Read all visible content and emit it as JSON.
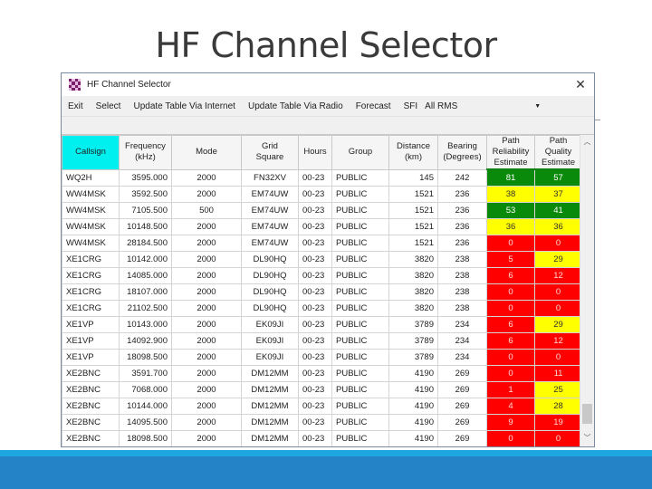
{
  "slide": {
    "title": "HF Channel Selector"
  },
  "window": {
    "title": "HF Channel Selector",
    "app_icon": "checkered-app-icon",
    "close_glyph": "✕"
  },
  "menu": {
    "items": [
      "Exit",
      "Select",
      "Update Table Via Internet",
      "Update Table Via Radio",
      "Forecast"
    ],
    "sfi_label": "SFI",
    "group_select": {
      "value": "All RMS",
      "arrow": "▼"
    }
  },
  "table": {
    "columns": [
      {
        "label": "Callsign",
        "sorted": true
      },
      {
        "label": "Frequency\n(kHz)"
      },
      {
        "label": "Mode"
      },
      {
        "label": "Grid\nSquare"
      },
      {
        "label": "Hours"
      },
      {
        "label": "Group"
      },
      {
        "label": "Distance\n(km)"
      },
      {
        "label": "Bearing\n(Degrees)"
      },
      {
        "label": "Path\nReliability\nEstimate"
      },
      {
        "label": "Path\nQuality\nEstimate"
      }
    ],
    "colors": {
      "green": "#0a8a0a",
      "yellow": "#ffff00",
      "red": "#ff0000",
      "sorted_header": "#00f0f0"
    },
    "rows": [
      {
        "callsign": "WQ2H",
        "freq": "3595.000",
        "mode": "2000",
        "grid": "FN32XV",
        "hours": "00-23",
        "group": "PUBLIC",
        "distance": "145",
        "bearing": "242",
        "reliability": "81",
        "rel_color": "green",
        "quality": "57",
        "qual_color": "green"
      },
      {
        "callsign": "WW4MSK",
        "freq": "3592.500",
        "mode": "2000",
        "grid": "EM74UW",
        "hours": "00-23",
        "group": "PUBLIC",
        "distance": "1521",
        "bearing": "236",
        "reliability": "38",
        "rel_color": "yellow",
        "quality": "37",
        "qual_color": "yellow"
      },
      {
        "callsign": "WW4MSK",
        "freq": "7105.500",
        "mode": "500",
        "grid": "EM74UW",
        "hours": "00-23",
        "group": "PUBLIC",
        "distance": "1521",
        "bearing": "236",
        "reliability": "53",
        "rel_color": "green",
        "quality": "41",
        "qual_color": "green"
      },
      {
        "callsign": "WW4MSK",
        "freq": "10148.500",
        "mode": "2000",
        "grid": "EM74UW",
        "hours": "00-23",
        "group": "PUBLIC",
        "distance": "1521",
        "bearing": "236",
        "reliability": "36",
        "rel_color": "yellow",
        "quality": "36",
        "qual_color": "yellow"
      },
      {
        "callsign": "WW4MSK",
        "freq": "28184.500",
        "mode": "2000",
        "grid": "EM74UW",
        "hours": "00-23",
        "group": "PUBLIC",
        "distance": "1521",
        "bearing": "236",
        "reliability": "0",
        "rel_color": "red",
        "quality": "0",
        "qual_color": "red"
      },
      {
        "callsign": "XE1CRG",
        "freq": "10142.000",
        "mode": "2000",
        "grid": "DL90HQ",
        "hours": "00-23",
        "group": "PUBLIC",
        "distance": "3820",
        "bearing": "238",
        "reliability": "5",
        "rel_color": "red",
        "quality": "29",
        "qual_color": "yellow"
      },
      {
        "callsign": "XE1CRG",
        "freq": "14085.000",
        "mode": "2000",
        "grid": "DL90HQ",
        "hours": "00-23",
        "group": "PUBLIC",
        "distance": "3820",
        "bearing": "238",
        "reliability": "6",
        "rel_color": "red",
        "quality": "12",
        "qual_color": "red"
      },
      {
        "callsign": "XE1CRG",
        "freq": "18107.000",
        "mode": "2000",
        "grid": "DL90HQ",
        "hours": "00-23",
        "group": "PUBLIC",
        "distance": "3820",
        "bearing": "238",
        "reliability": "0",
        "rel_color": "red",
        "quality": "0",
        "qual_color": "red"
      },
      {
        "callsign": "XE1CRG",
        "freq": "21102.500",
        "mode": "2000",
        "grid": "DL90HQ",
        "hours": "00-23",
        "group": "PUBLIC",
        "distance": "3820",
        "bearing": "238",
        "reliability": "0",
        "rel_color": "red",
        "quality": "0",
        "qual_color": "red"
      },
      {
        "callsign": "XE1VP",
        "freq": "10143.000",
        "mode": "2000",
        "grid": "EK09JI",
        "hours": "00-23",
        "group": "PUBLIC",
        "distance": "3789",
        "bearing": "234",
        "reliability": "6",
        "rel_color": "red",
        "quality": "29",
        "qual_color": "yellow"
      },
      {
        "callsign": "XE1VP",
        "freq": "14092.900",
        "mode": "2000",
        "grid": "EK09JI",
        "hours": "00-23",
        "group": "PUBLIC",
        "distance": "3789",
        "bearing": "234",
        "reliability": "6",
        "rel_color": "red",
        "quality": "12",
        "qual_color": "red"
      },
      {
        "callsign": "XE1VP",
        "freq": "18098.500",
        "mode": "2000",
        "grid": "EK09JI",
        "hours": "00-23",
        "group": "PUBLIC",
        "distance": "3789",
        "bearing": "234",
        "reliability": "0",
        "rel_color": "red",
        "quality": "0",
        "qual_color": "red"
      },
      {
        "callsign": "XE2BNC",
        "freq": "3591.700",
        "mode": "2000",
        "grid": "DM12MM",
        "hours": "00-23",
        "group": "PUBLIC",
        "distance": "4190",
        "bearing": "269",
        "reliability": "0",
        "rel_color": "red",
        "quality": "11",
        "qual_color": "red"
      },
      {
        "callsign": "XE2BNC",
        "freq": "7068.000",
        "mode": "2000",
        "grid": "DM12MM",
        "hours": "00-23",
        "group": "PUBLIC",
        "distance": "4190",
        "bearing": "269",
        "reliability": "1",
        "rel_color": "red",
        "quality": "25",
        "qual_color": "yellow"
      },
      {
        "callsign": "XE2BNC",
        "freq": "10144.000",
        "mode": "2000",
        "grid": "DM12MM",
        "hours": "00-23",
        "group": "PUBLIC",
        "distance": "4190",
        "bearing": "269",
        "reliability": "4",
        "rel_color": "red",
        "quality": "28",
        "qual_color": "yellow"
      },
      {
        "callsign": "XE2BNC",
        "freq": "14095.500",
        "mode": "2000",
        "grid": "DM12MM",
        "hours": "00-23",
        "group": "PUBLIC",
        "distance": "4190",
        "bearing": "269",
        "reliability": "9",
        "rel_color": "red",
        "quality": "19",
        "qual_color": "red"
      },
      {
        "callsign": "XE2BNC",
        "freq": "18098.500",
        "mode": "2000",
        "grid": "DM12MM",
        "hours": "00-23",
        "group": "PUBLIC",
        "distance": "4190",
        "bearing": "269",
        "reliability": "0",
        "rel_color": "red",
        "quality": "0",
        "qual_color": "red"
      }
    ],
    "scrollbar": {
      "up_glyph": "︿",
      "down_glyph": "﹀"
    }
  }
}
